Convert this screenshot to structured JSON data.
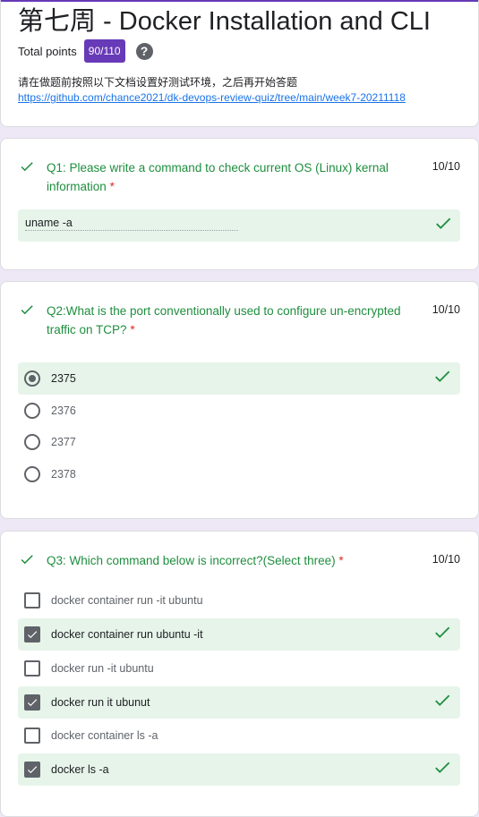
{
  "header": {
    "title": "第七周 - Docker Installation and CLI",
    "total_points_label": "Total points",
    "score": "90/110",
    "help_icon": "?",
    "description": "请在做题前按照以下文档设置好测试环境，之后再开始答题",
    "link": "https://github.com/chance2021/dk-devops-review-quiz/tree/main/week7-20211118"
  },
  "q1": {
    "text": "Q1: Please write a command to check current OS (Linux) kernal information",
    "required": "*",
    "score": "10/10",
    "answer": "uname -a"
  },
  "q2": {
    "text": "Q2:What is the port conventionally used to configure un-encrypted traffic on TCP?",
    "required": "*",
    "score": "10/10",
    "options": [
      "2375",
      "2376",
      "2377",
      "2378"
    ],
    "selected": "2375"
  },
  "q3": {
    "text": "Q3: Which command below is incorrect?(Select three)",
    "required": "*",
    "score": "10/10",
    "options": [
      "docker container run -it ubuntu",
      "docker container run ubuntu -it",
      "docker run -it ubuntu",
      "docker run it ubunut",
      "docker container ls -a",
      "docker ls -a"
    ],
    "checked": [
      "docker container run ubuntu -it",
      "docker run it ubunut",
      "docker ls -a"
    ]
  },
  "icons": {
    "correct": "check-icon",
    "help": "help-icon"
  },
  "colors": {
    "accent": "#673ab7",
    "correct_green": "#1e8e3e",
    "correct_bg": "#e6f4ea",
    "link": "#1a73e8",
    "required": "#d93025"
  }
}
